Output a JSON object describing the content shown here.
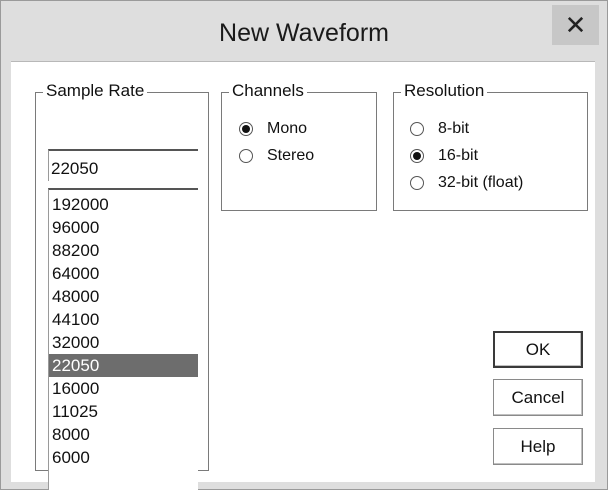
{
  "window": {
    "title": "New Waveform",
    "close_label": "✕"
  },
  "sample_rate": {
    "legend": "Sample Rate",
    "current_value": "22050",
    "options": [
      "192000",
      "96000",
      "88200",
      "64000",
      "48000",
      "44100",
      "32000",
      "22050",
      "16000",
      "11025",
      "8000",
      "6000"
    ],
    "selected": "22050"
  },
  "channels": {
    "legend": "Channels",
    "options": [
      {
        "label": "Mono",
        "checked": true
      },
      {
        "label": "Stereo",
        "checked": false
      }
    ]
  },
  "resolution": {
    "legend": "Resolution",
    "options": [
      {
        "label": "8-bit",
        "checked": false
      },
      {
        "label": "16-bit",
        "checked": true
      },
      {
        "label": "32-bit (float)",
        "checked": false
      }
    ]
  },
  "buttons": {
    "ok": "OK",
    "cancel": "Cancel",
    "help": "Help"
  }
}
